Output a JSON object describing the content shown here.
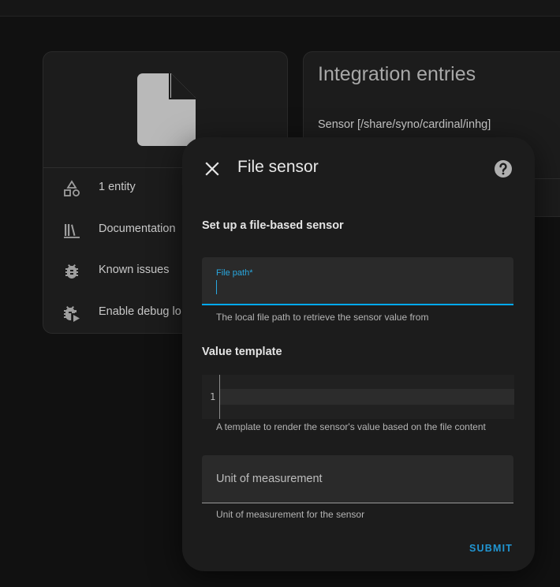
{
  "integration_card": {
    "info_rows": [
      {
        "icon": "shapes-icon",
        "label": "1 entity"
      },
      {
        "icon": "book-shelf-icon",
        "label": "Documentation"
      },
      {
        "icon": "bug-icon",
        "label": "Known issues"
      },
      {
        "icon": "bug-play-icon",
        "label": "Enable debug lo"
      }
    ]
  },
  "entries_card": {
    "title": "Integration entries",
    "entry_label": "Sensor [/share/syno/cardinal/inhg]"
  },
  "dialog": {
    "title": "File sensor",
    "subtitle": "Set up a file-based sensor",
    "file_path": {
      "label": "File path*",
      "value": "",
      "helper": "The local file path to retrieve the sensor value from"
    },
    "value_template": {
      "label": "Value template",
      "line_number": "1",
      "helper": "A template to render the sensor's value based on the file content"
    },
    "unit": {
      "placeholder": "Unit of measurement",
      "helper": "Unit of measurement for the sensor"
    },
    "submit_label": "SUBMIT"
  },
  "colors": {
    "accent": "#03a9f4",
    "submit": "#2196d3",
    "background": "#111111",
    "card": "#1c1c1c"
  }
}
